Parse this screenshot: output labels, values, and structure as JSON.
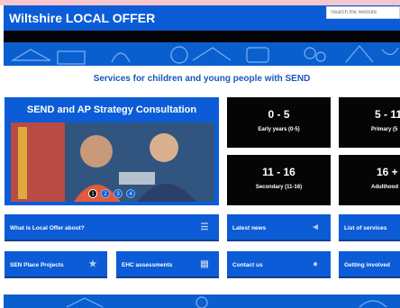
{
  "header": {
    "logo_text": "Wiltshire LOCAL OFFER",
    "search_placeholder": "Search the website"
  },
  "intro": {
    "heading": "Services for children and young people with SEND"
  },
  "promo": {
    "title": "SEND and AP Strategy Consultation",
    "slides": [
      "1",
      "2",
      "3",
      "4"
    ],
    "active_slide": "1"
  },
  "age_groups": [
    {
      "range": "0 - 5",
      "label": "Early years (0-5)"
    },
    {
      "range": "5 - 11",
      "label": "Primary (5"
    },
    {
      "range": "11 - 16",
      "label": "Secondary (11-16)"
    },
    {
      "range": "16 +",
      "label": "Adulthood ("
    }
  ],
  "links": [
    {
      "label": "What is Local Offer about?",
      "icon": "signpost-icon"
    },
    {
      "label": "Latest news",
      "icon": "megaphone-icon"
    },
    {
      "label": "List of services",
      "icon": ""
    },
    {
      "label": "SEN Place Projects",
      "icon": "star-icon"
    },
    {
      "label": "EHC assessments",
      "icon": "document-icon"
    },
    {
      "label": "Contact us",
      "icon": "chat-icon"
    },
    {
      "label": "Getting involved",
      "icon": ""
    }
  ],
  "colors": {
    "brand_blue": "#0b5cd6",
    "tile_black": "#050505",
    "heading_blue": "#1b57b8"
  }
}
